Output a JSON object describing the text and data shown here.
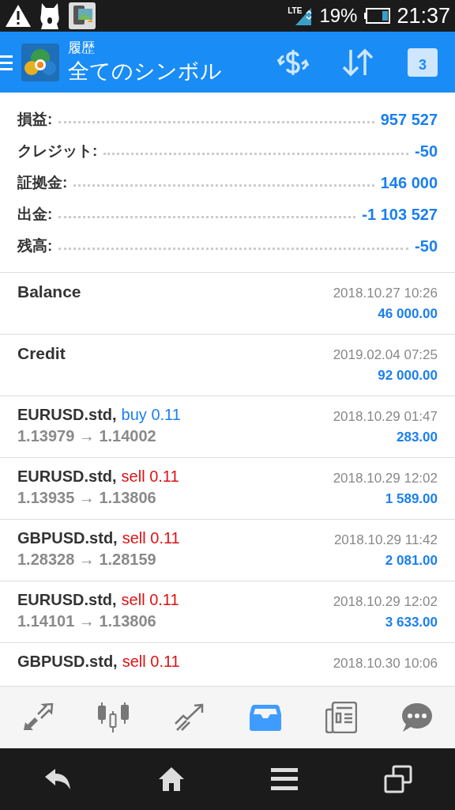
{
  "status_bar": {
    "network": "LTE",
    "battery": "19%",
    "time": "21:37"
  },
  "header": {
    "subtitle": "履歴",
    "title": "全てのシンボル",
    "calendar_day": "3"
  },
  "summary": [
    {
      "label": "損益:",
      "value": "957 527"
    },
    {
      "label": "クレジット:",
      "value": "-50"
    },
    {
      "label": "証拠金:",
      "value": "146 000"
    },
    {
      "label": "出金:",
      "value": "-1 103 527"
    },
    {
      "label": "残高:",
      "value": "-50"
    }
  ],
  "deals": [
    {
      "kind": "balance",
      "title": "Balance",
      "time": "2018.10.27 10:26",
      "amount": "46 000.00"
    },
    {
      "kind": "balance",
      "title": "Credit",
      "time": "2019.02.04 07:25",
      "amount": "92 000.00"
    },
    {
      "kind": "trade",
      "symbol": "EURUSD.std,",
      "buy": true,
      "order": "buy 0.11",
      "prices": "1.13979 → 1.14002",
      "time": "2018.10.29 01:47",
      "amount": "283.00"
    },
    {
      "kind": "trade",
      "symbol": "EURUSD.std,",
      "buy": false,
      "order": "sell 0.11",
      "prices": "1.13935 → 1.13806",
      "time": "2018.10.29 12:02",
      "amount": "1 589.00"
    },
    {
      "kind": "trade",
      "symbol": "GBPUSD.std,",
      "buy": false,
      "order": "sell 0.11",
      "prices": "1.28328 → 1.28159",
      "time": "2018.10.29 11:42",
      "amount": "2 081.00"
    },
    {
      "kind": "trade",
      "symbol": "EURUSD.std,",
      "buy": false,
      "order": "sell 0.11",
      "prices": "1.14101 → 1.13806",
      "time": "2018.10.29 12:02",
      "amount": "3 633.00"
    },
    {
      "kind": "trade",
      "symbol": "GBPUSD.std,",
      "buy": false,
      "order": "sell 0.11",
      "time": "2018.10.30 10:06"
    }
  ],
  "bottom_nav": [
    {
      "kind": "quotes",
      "selected": false
    },
    {
      "kind": "chart",
      "selected": false
    },
    {
      "kind": "trade",
      "selected": false
    },
    {
      "kind": "history",
      "selected": true
    },
    {
      "kind": "news",
      "selected": false
    },
    {
      "kind": "chat",
      "selected": false
    }
  ]
}
